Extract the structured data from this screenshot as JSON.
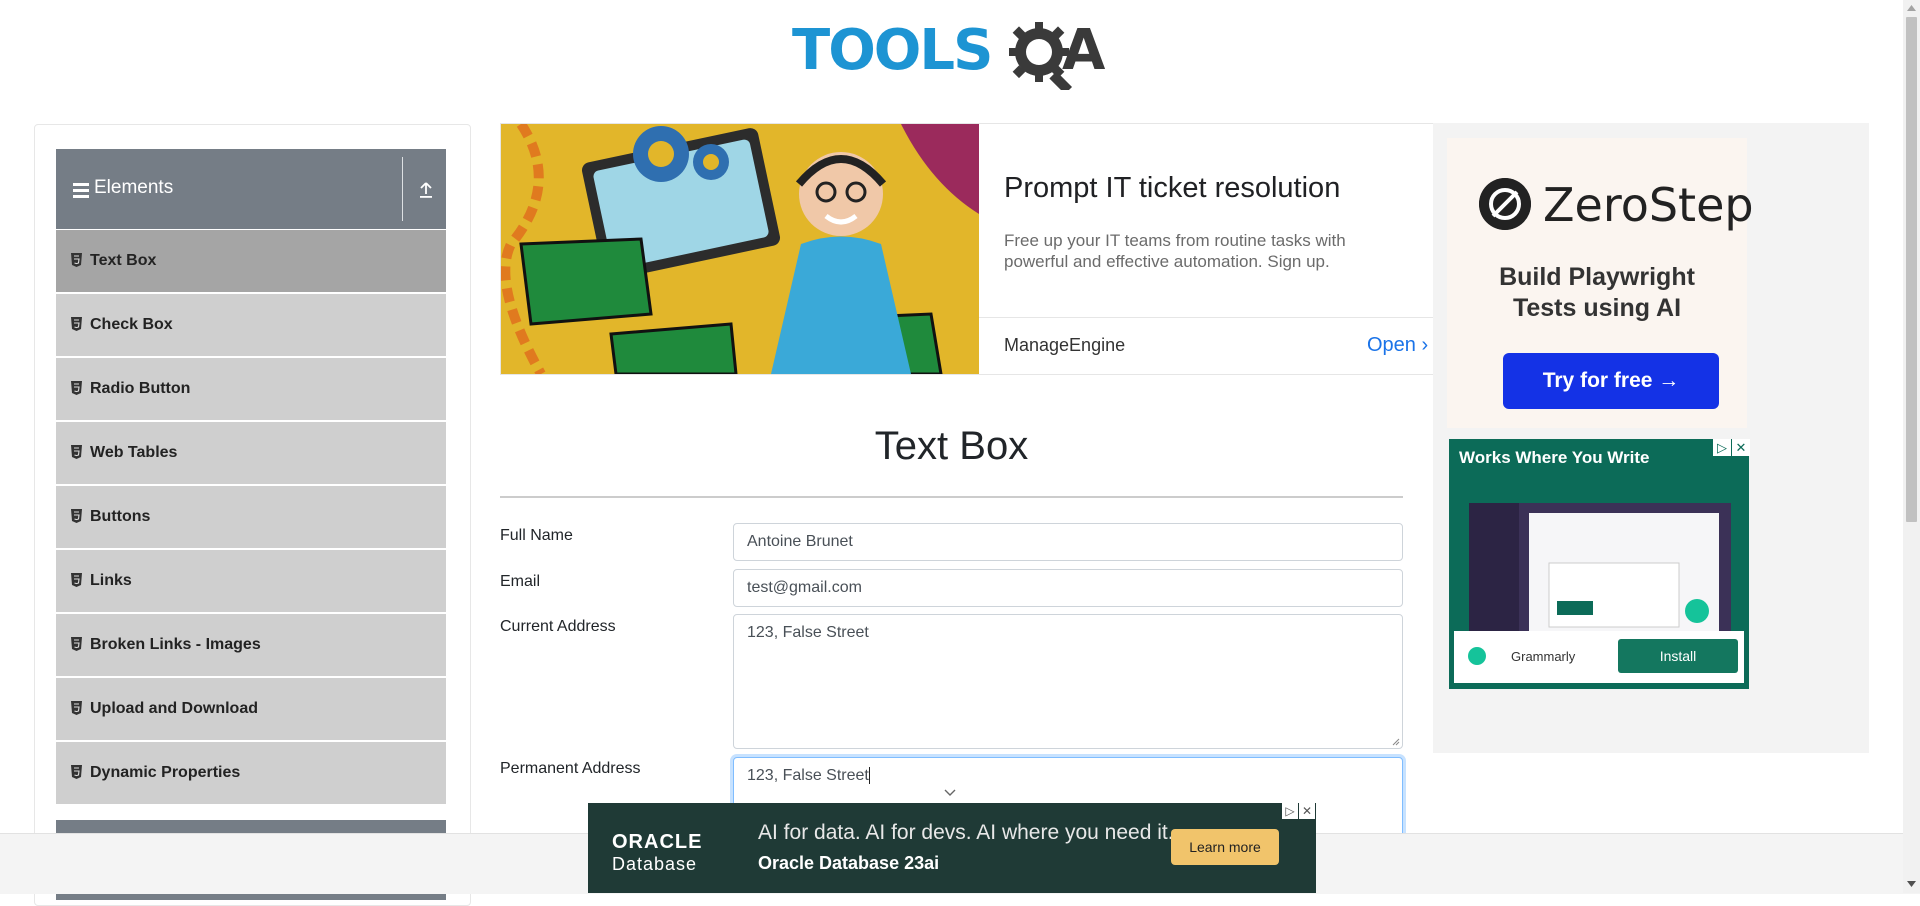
{
  "logo": {
    "main": "TOOLS",
    "accent": "A",
    "brand_color": "#1d94d3"
  },
  "sidebar": {
    "group_title": "Elements",
    "items": [
      {
        "label": "Text Box",
        "active": true
      },
      {
        "label": "Check Box"
      },
      {
        "label": "Radio Button"
      },
      {
        "label": "Web Tables"
      },
      {
        "label": "Buttons"
      },
      {
        "label": "Links"
      },
      {
        "label": "Broken Links - Images"
      },
      {
        "label": "Upload and Download"
      },
      {
        "label": "Dynamic Properties"
      }
    ]
  },
  "ad_top": {
    "title": "Prompt IT ticket resolution",
    "description": "Free up your IT teams from routine tasks with powerful and effective automation. Sign up.",
    "brand": "ManageEngine",
    "cta": "Open"
  },
  "ad_right": {
    "zerostep_name": "ZeroStep",
    "zerostep_headline": "Build Playwright Tests using AI",
    "zerostep_cta": "Try for free →",
    "grammarly_title": "Works Where You Write",
    "grammarly_brand": "Grammarly",
    "grammarly_cta": "Install"
  },
  "form": {
    "page_title": "Text Box",
    "full_name_label": "Full Name",
    "full_name_value": "Antoine Brunet",
    "email_label": "Email",
    "email_value": "test@gmail.com",
    "current_address_label": "Current Address",
    "current_address_value": "123, False Street",
    "permanent_address_label": "Permanent Address",
    "permanent_address_value": "123, False Street"
  },
  "ad_bottom": {
    "logo_line1": "ORACLE",
    "logo_line2": "Database",
    "line1": "AI for data. AI for devs. AI where you need it.",
    "line2": "Oracle Database 23ai",
    "cta": "Learn more"
  }
}
